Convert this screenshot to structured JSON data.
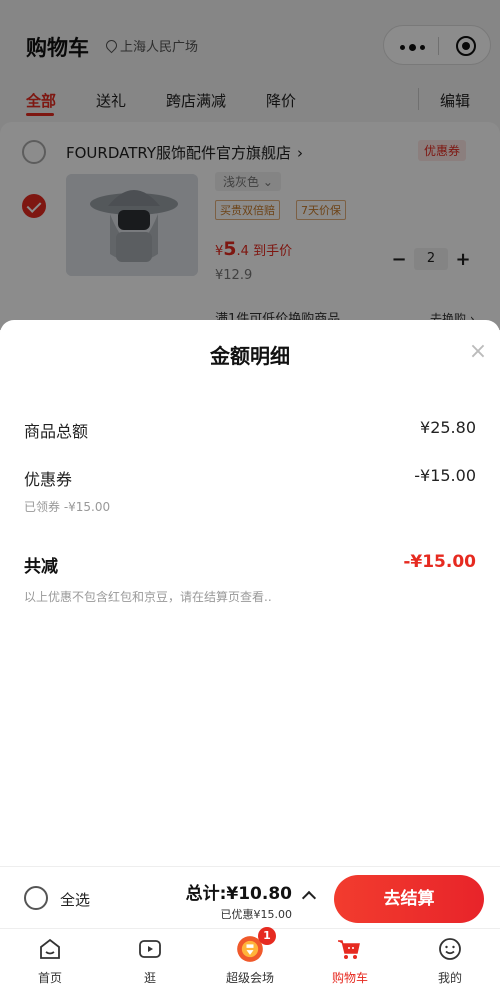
{
  "header": {
    "title": "购物车",
    "location": "上海人民广场"
  },
  "tabs": [
    {
      "label": "全部"
    },
    {
      "label": "送礼"
    },
    {
      "label": "跨店满减"
    },
    {
      "label": "降价"
    }
  ],
  "edit_label": "编辑",
  "shop": {
    "name": "FOURDATRY服饰配件官方旗舰店",
    "arrow": "›",
    "coupon_tag": "优惠券"
  },
  "product": {
    "spec": "浅灰色",
    "badges": [
      "买贵双倍赔",
      "7天价保"
    ],
    "price_symbol": "¥",
    "price_int": "5",
    "price_dec": ".4",
    "price_suffix": "到手价",
    "original_price": "¥12.9",
    "quantity": "2",
    "minus": "−",
    "plus": "+"
  },
  "promo": {
    "text": "满1件可低价换购商品",
    "link": "去换购 ›"
  },
  "sheet": {
    "title": "金额明细",
    "close": "×",
    "rows": [
      {
        "label": "商品总额",
        "value": "¥25.80"
      },
      {
        "label": "优惠券",
        "value": "-¥15.00",
        "sub": "已领券 -¥15.00"
      }
    ],
    "total_label": "共减",
    "total_value": "-¥15.00",
    "note": "以上优惠不包含红包和京豆，请在结算页查看.."
  },
  "checkout": {
    "select_all": "全选",
    "total": "总计:¥10.80",
    "saved": "已优惠¥15.00",
    "button": "去结算"
  },
  "tabbar": {
    "items": [
      {
        "label": "首页",
        "icon": "home-icon"
      },
      {
        "label": "逛",
        "icon": "video-icon"
      },
      {
        "label": "超级会场",
        "icon": "venue-icon",
        "badge": "1"
      },
      {
        "label": "购物车",
        "icon": "cart-icon"
      },
      {
        "label": "我的",
        "icon": "profile-icon"
      }
    ]
  },
  "colors": {
    "accent": "#e62a20",
    "badge_orange": "#c77b2a"
  }
}
